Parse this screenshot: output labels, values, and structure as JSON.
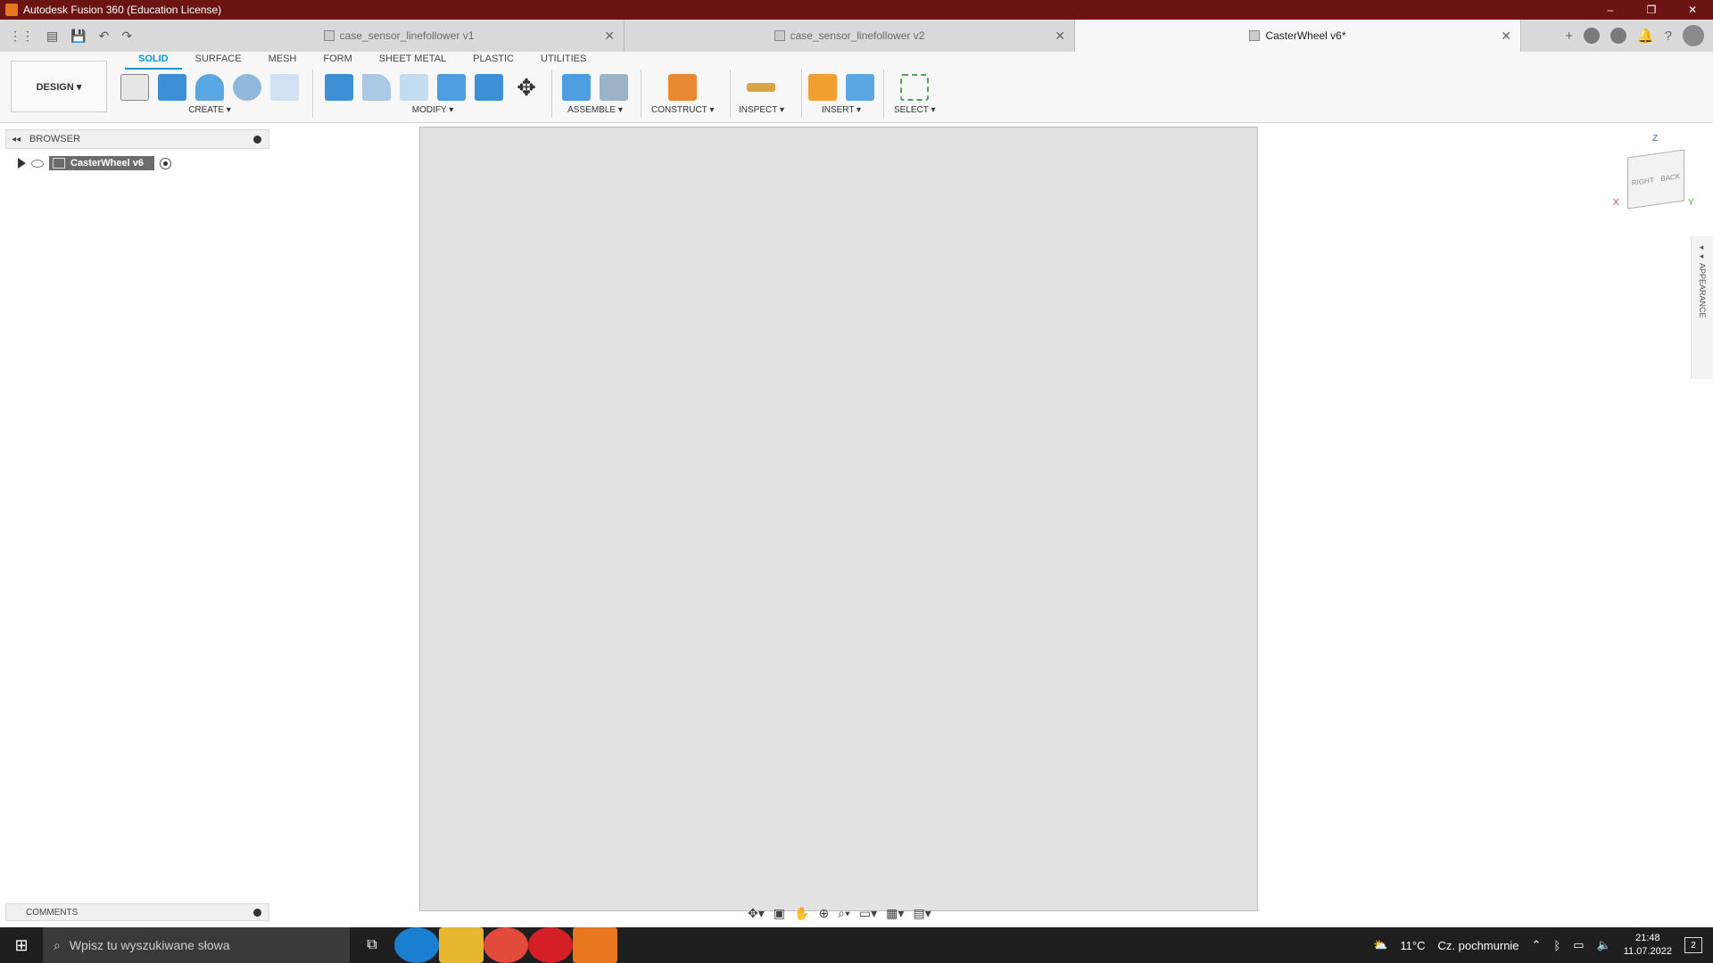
{
  "window": {
    "title": "Autodesk Fusion 360 (Education License)",
    "controls": [
      "–",
      "❐",
      "✕"
    ]
  },
  "quick_access": {
    "grid_icon": "⋮⋮",
    "file_icon": "▤",
    "save_icon": "💾",
    "undo_icon": "↶",
    "redo_icon": "↷"
  },
  "tabs": [
    {
      "label": "case_sensor_linefollower v1",
      "active": false
    },
    {
      "label": "case_sensor_linefollower v2",
      "active": false
    },
    {
      "label": "CasterWheel v6*",
      "active": true
    }
  ],
  "tab_close": "✕",
  "header_icons": {
    "add": "+",
    "help": "?"
  },
  "ribbon": {
    "workspace": "DESIGN ▾",
    "tabs": [
      "SOLID",
      "SURFACE",
      "MESH",
      "FORM",
      "SHEET METAL",
      "PLASTIC",
      "UTILITIES"
    ],
    "active_tab": "SOLID",
    "groups": {
      "create": "CREATE ▾",
      "modify": "MODIFY ▾",
      "assemble": "ASSEMBLE ▾",
      "construct": "CONSTRUCT ▾",
      "inspect": "INSPECT ▾",
      "insert": "INSERT ▾",
      "select": "SELECT ▾"
    }
  },
  "browser": {
    "collapse": "◂◂",
    "title": "BROWSER",
    "root_component": "CasterWheel v6"
  },
  "viewcube": {
    "z": "Z",
    "x": "X",
    "y": "Y",
    "right": "RIGHT",
    "back": "BACK"
  },
  "appearance_panel": "◂◂ APPEARANCE",
  "comments": {
    "title": "COMMENTS"
  },
  "navbar": [
    "✥▾",
    "▣",
    "✋",
    "⊕",
    "⌕▾",
    "▭▾",
    "▦▾",
    "▤▾"
  ],
  "taskbar": {
    "start": "⊞",
    "search_placeholder": "Wpisz tu wyszukiwane słowa",
    "weather_temp": "11°C",
    "weather_text": "Cz. pochmurnie",
    "time": "21:48",
    "date": "11.07.2022",
    "notifications": "2",
    "colors": {
      "edge": "#1a7fd1",
      "explorer": "#e8b730",
      "chrome": "#e24a3b",
      "opera": "#d41f27",
      "fusion": "#e8761e"
    }
  }
}
